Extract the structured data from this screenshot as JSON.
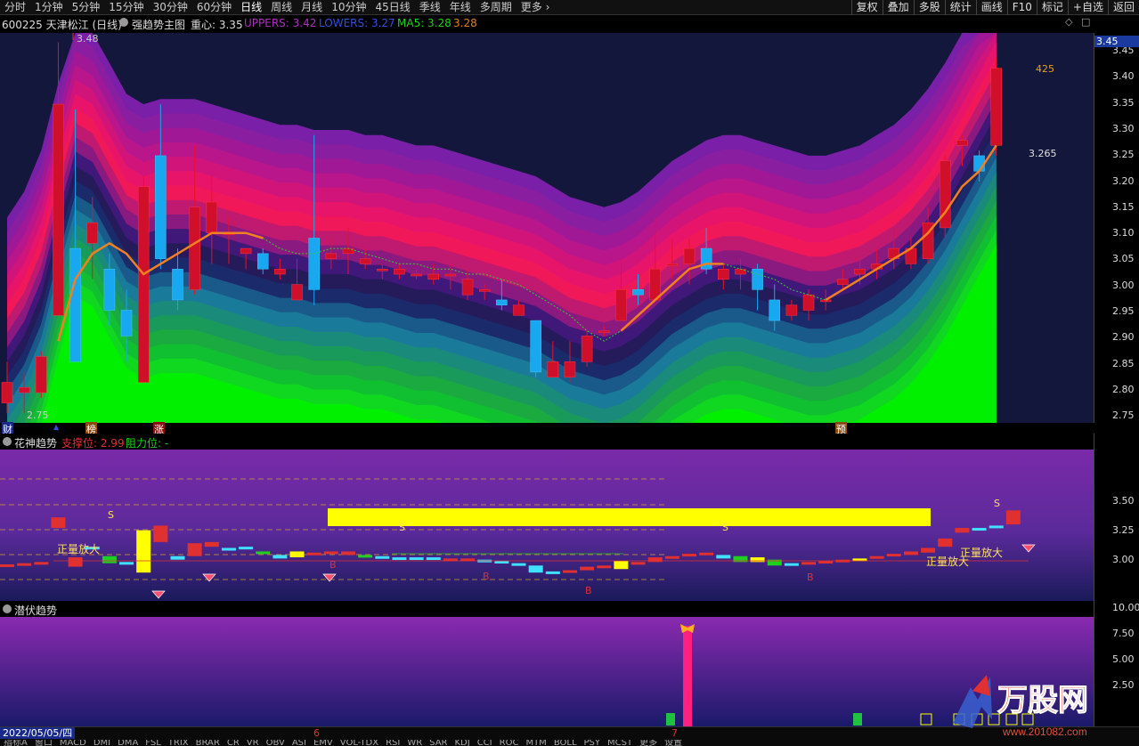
{
  "toolbar": {
    "periods": [
      "分时",
      "1分钟",
      "5分钟",
      "15分钟",
      "30分钟",
      "60分钟",
      "日线",
      "周线",
      "月线",
      "10分钟",
      "45日线",
      "季线",
      "年线",
      "多周期",
      "更多"
    ],
    "active_period": "日线",
    "right_tools": [
      "复权",
      "叠加",
      "多股",
      "统计",
      "画线",
      "F10",
      "标记",
      "+自选",
      "返回"
    ]
  },
  "info": {
    "stock": "600225 天津松江 (日线)",
    "indicator": "强趋势主图",
    "center_label": "重心: 3.35",
    "uppers": "UPPERS: 3.42",
    "lowers": "LOWERS: 3.27",
    "ma5": "MA5: 3.28",
    "extra": "3.28"
  },
  "price_panel": {
    "axis_labels": [
      "3.45",
      "3.40",
      "3.35",
      "3.30",
      "3.25",
      "3.20",
      "3.15",
      "3.10",
      "3.05",
      "3.00",
      "2.95",
      "2.90",
      "2.85",
      "2.80",
      "2.75"
    ],
    "current_price": "3.45",
    "annotations": {
      "high_mark": "3.48",
      "low_mark": "2.75",
      "right_425": "425",
      "right_3265": "3.265"
    },
    "event_tags": [
      "财",
      "榜",
      "涨",
      "预"
    ]
  },
  "indicator1": {
    "name": "花神趋势",
    "support": "支撑位: 2.99",
    "resistance": "阻力位: -",
    "axis_labels": [
      "3.50",
      "3.25",
      "3.00"
    ],
    "labels": {
      "zheng1": "正量放大",
      "zheng2": "正量放大",
      "zheng3": "正量放大",
      "s": "S",
      "b": "B"
    }
  },
  "indicator2": {
    "name": "潜伏趋势",
    "axis_labels": [
      "10.00",
      "7.50",
      "5.00",
      "2.50"
    ]
  },
  "bottom": {
    "date": "2022/05/05/四",
    "month_markers": [
      "6",
      "7"
    ],
    "tabs": [
      "指标A",
      "窗口",
      "MACD",
      "DMI",
      "DMA",
      "FSL",
      "TRIX",
      "BRAR",
      "CR",
      "VR",
      "OBV",
      "ASI",
      "EMV",
      "VOL-TDX",
      "RSI",
      "WR",
      "SAR",
      "KDJ",
      "CCI",
      "ROC",
      "MTM",
      "BOLL",
      "PSY",
      "MCST",
      "更多",
      "设置"
    ],
    "watermark": "万股网",
    "watermark_url": "www.201082.com"
  },
  "colors": {
    "up": "#e8102a",
    "down": "#19a8f0",
    "ma_line": "#f08020",
    "accent_blue": "#1a2a8a"
  }
}
